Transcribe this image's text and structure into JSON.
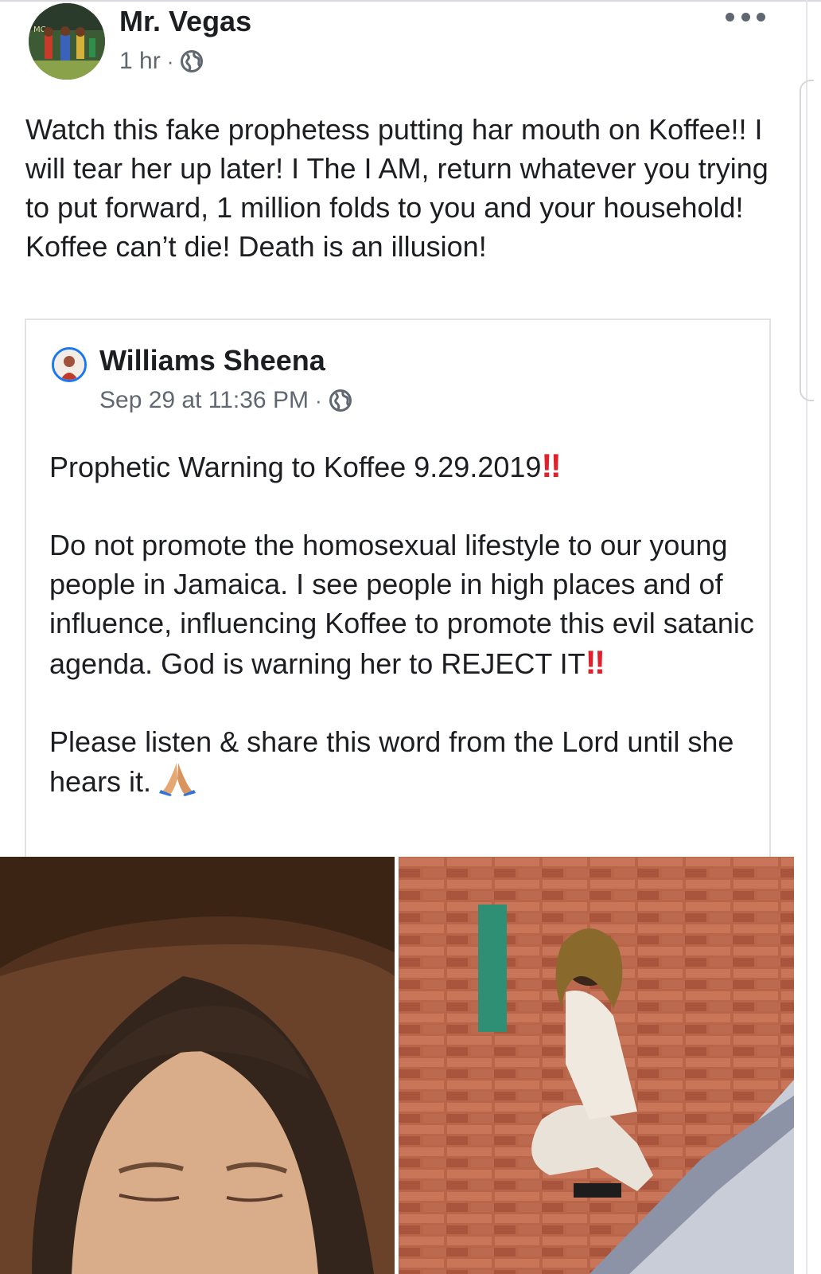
{
  "post": {
    "author": "Mr. Vegas",
    "time": "1 hr",
    "separator": "·",
    "text": "Watch this fake prophetess putting har mouth on Koffee!! I will tear her up later! I The I AM, return whatever you trying to put forward, 1 million folds to you and your household! Koffee can’t die! Death is an illusion!"
  },
  "shared": {
    "author": "Williams Sheena",
    "date": "Sep 29 at 11:36 PM",
    "separator": "·",
    "line1": "Prophetic Warning to Koffee 9.29.2019",
    "line2": "Do not promote the homosexual lifestyle to our young people in Jamaica. I see people in high places and of influence, influencing Koffee to promote this evil satanic agenda. God is warning her to REJECT IT",
    "line3": "Please listen & share this word from the Lord until she hears it.",
    "bang_glyph": "‼",
    "emoji": "praying-hands"
  },
  "icons": {
    "more": "more-options-icon",
    "privacy": "globe-icon"
  },
  "colors": {
    "name": "#1c1e21",
    "meta": "#616770",
    "accent": "#1877f2",
    "bang": "#e0202a"
  }
}
